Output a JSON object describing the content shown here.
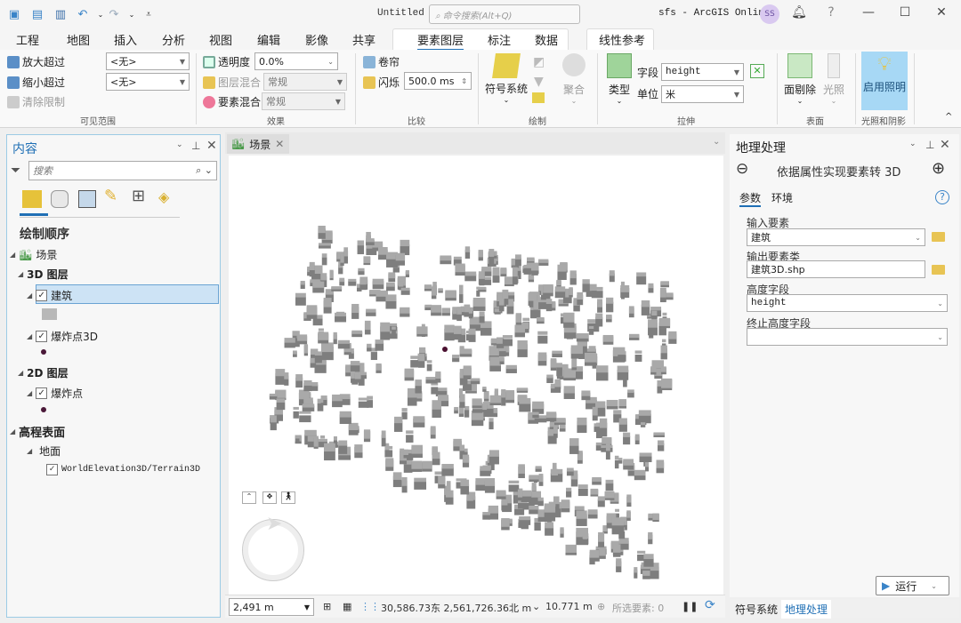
{
  "titlebar": {
    "doc_title": "Untitled",
    "search_placeholder": "命令搜索(Alt+Q)",
    "portal": "sfs - ArcGIS Online",
    "avatar": "SS",
    "quick_access": [
      "new-project-icon",
      "open-project-icon",
      "save-project-icon",
      "undo-icon",
      "redo-icon",
      "customize-icon"
    ]
  },
  "ribbon_tabs": {
    "items": [
      "工程",
      "地图",
      "插入",
      "分析",
      "视图",
      "编辑",
      "影像",
      "共享"
    ],
    "contextual": [
      "要素图层",
      "标注",
      "数据"
    ],
    "linear": "线性参考",
    "active": "要素图层"
  },
  "ribbon": {
    "visibility": {
      "zoom_in_beyond": "放大超过",
      "zoom_in_value": "<无>",
      "zoom_out_beyond": "缩小超过",
      "zoom_out_value": "<无>",
      "clear_limits": "清除限制",
      "group": "可见范围"
    },
    "effects": {
      "transparency": "透明度",
      "transparency_value": "0.0%",
      "layer_blend": "图层混合",
      "layer_blend_value": "常规",
      "feature_blend": "要素混合",
      "feature_blend_value": "常规",
      "group": "效果"
    },
    "compare": {
      "swipe": "卷帘",
      "flicker": "闪烁",
      "flicker_value": "500.0  ms",
      "group": "比较"
    },
    "drawing": {
      "symbology": "符号系统",
      "aggregation": "聚合",
      "group": "绘制"
    },
    "extrusion": {
      "type": "类型",
      "field": "字段",
      "field_value": "height",
      "unit": "单位",
      "unit_value": "米",
      "group": "拉伸"
    },
    "faces": {
      "face_culling": "面剔除",
      "lighting": "光照",
      "group": "表面"
    },
    "light": {
      "enable_lighting": "启用照明",
      "group": "光照和阴影"
    }
  },
  "contents": {
    "title": "内容",
    "search_placeholder": "搜索",
    "section": "绘制顺序",
    "scene": "场景",
    "layers_3d": "3D 图层",
    "building": "建筑",
    "explosion_3d": "爆炸点3D",
    "layers_2d": "2D 图层",
    "explosion": "爆炸点",
    "elevation": "高程表面",
    "ground": "地面",
    "terrain": "WorldElevation3D/Terrain3D"
  },
  "view": {
    "tab": "场景"
  },
  "statusbar": {
    "scale": "2,491 m",
    "coords": "30,586.73东 2,561,726.36北 m",
    "elevation": "10.771 m",
    "selected": "所选要素: 0"
  },
  "geoprocessing": {
    "title": "地理处理",
    "tool": "依据属性实现要素转 3D",
    "tabs": [
      "参数",
      "环境"
    ],
    "input_label": "输入要素",
    "input_value": "建筑",
    "output_label": "输出要素类",
    "output_value": "建筑3D.shp",
    "height_label": "高度字段",
    "height_value": "height",
    "to_height_label": "终止高度字段",
    "to_height_value": "",
    "run": "运行"
  },
  "bottom_tabs": [
    "符号系统",
    "地理处理"
  ],
  "colors": {
    "accent": "#1f6fb5",
    "selection": "#cde3f5",
    "building": "#8c8c8c",
    "light_on": "#a7d8f5"
  }
}
